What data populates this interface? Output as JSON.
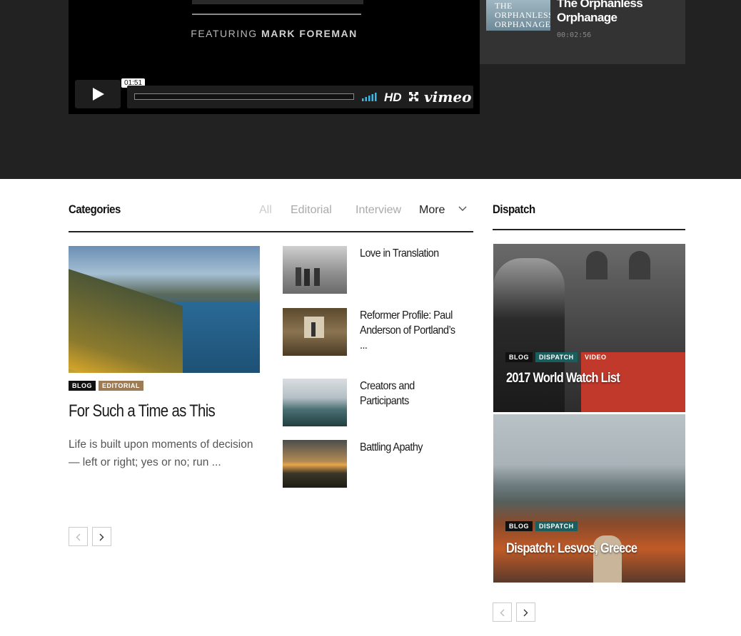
{
  "video_player": {
    "featuring_prefix": "FEATURING",
    "featuring_name": "MARK FOREMAN",
    "time_tooltip": "01:51",
    "hd_label": "HD",
    "brand": "vimeo",
    "progress_fraction": 0.0
  },
  "next_video": {
    "thumb_text": "THE ORPHANLESS ORPHANAGE",
    "title": "The Orphanless Orphanage",
    "duration": "00:02:56"
  },
  "categories": {
    "heading": "Categories",
    "tabs": [
      {
        "label": "All"
      },
      {
        "label": "Editorial"
      },
      {
        "label": "Interview"
      },
      {
        "label": "More"
      }
    ]
  },
  "featured": {
    "badges": [
      "BLOG",
      "EDITORIAL"
    ],
    "title": "For Such a Time as This",
    "excerpt": "Life is built upon moments of decision— left or right; yes or no; run ..."
  },
  "list": [
    {
      "title": "Love in Translation"
    },
    {
      "title": "Reformer Profile: Paul Anderson of Portland’s ..."
    },
    {
      "title": "Creators and Participants"
    },
    {
      "title": "Battling Apathy"
    }
  ],
  "dispatch": {
    "heading": "Dispatch",
    "cards": [
      {
        "badges": [
          "BLOG",
          "DISPATCH",
          "VIDEO"
        ],
        "title": "2017 World Watch List"
      },
      {
        "badges": [
          "BLOG",
          "DISPATCH"
        ],
        "title": "Dispatch: Lesvos, Greece"
      }
    ]
  },
  "colors": {
    "top_band": "#222222",
    "blog_badge": "#111111",
    "editorial_badge": "#9c7b55",
    "dispatch_badge": "#1b5e5e",
    "video_badge": "#c0392b"
  }
}
